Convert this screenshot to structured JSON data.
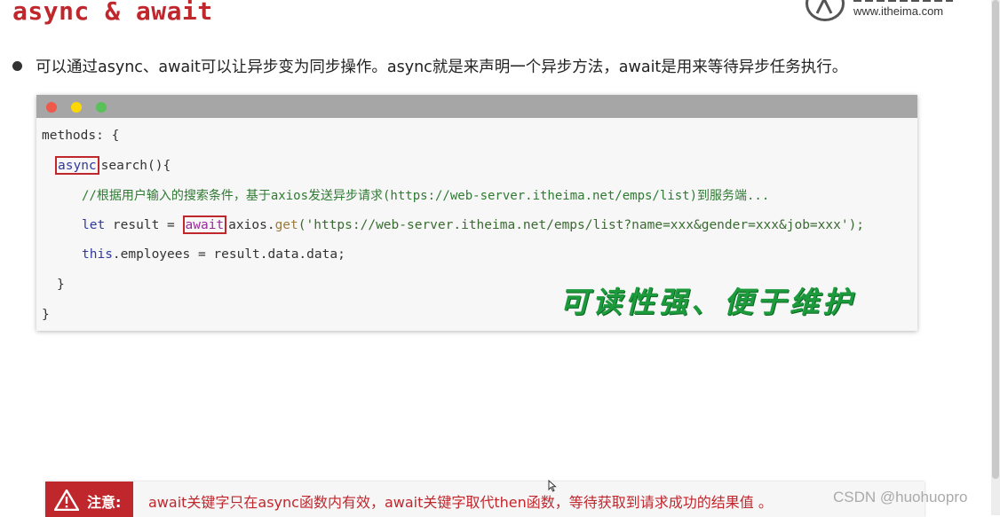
{
  "title": "async & await",
  "logo": {
    "url": "www.itheima.com"
  },
  "intro": "可以通过async、await可以让异步变为同步操作。async就是来声明一个异步方法，await是用来等待异步任务执行。",
  "code": {
    "line1": "methods: {",
    "async_kw": "async",
    "line2_rest": "search(){",
    "comment": "//根据用户输入的搜索条件，基于axios发送异步请求(https://web-server.itheima.net/emps/list)到服务端...",
    "let_kw": "let",
    "var_part": " result = ",
    "await_kw": "await",
    "axios_obj": "axios.",
    "get_method": "get",
    "url_string": "('https://web-server.itheima.net/emps/list?name=xxx&gender=xxx&job=xxx');",
    "this_kw": "this",
    "assign_rest": ".employees = result.data.data;",
    "close_inner": "}",
    "close_outer": "}"
  },
  "slogan": "可读性强、便于维护",
  "note": {
    "label": "注意:",
    "text": "await关键字只在async函数内有效，await关键字取代then函数，等待获取到请求成功的结果值 。"
  },
  "watermark": "CSDN @huohuopro",
  "colors": {
    "accent": "#c0272d",
    "slogan": "#1c9a3c"
  }
}
